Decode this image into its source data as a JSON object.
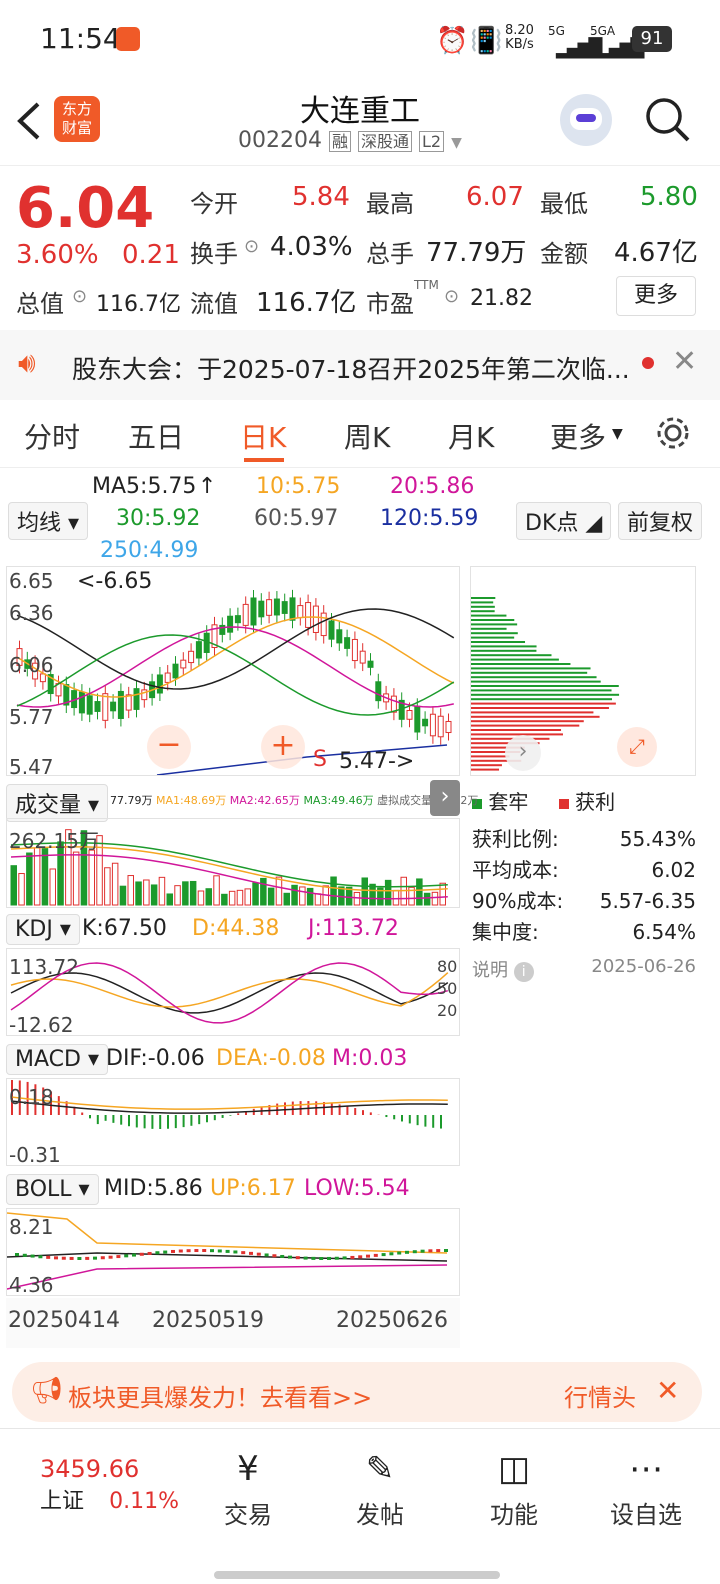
{
  "status_bar": {
    "time": "11:54",
    "net_speed": "8.20",
    "net_unit": "KB/s",
    "sig1": "5G",
    "sig2": "5GA",
    "battery": "91"
  },
  "header": {
    "logo_line1": "东方",
    "logo_line2": "财富",
    "title": "大连重工",
    "code": "002204",
    "tag1": "融",
    "tag2": "深股通",
    "tag3": "L2"
  },
  "quote": {
    "price": "6.04",
    "change_pct": "3.60%",
    "change_amt": "0.21",
    "open_label": "今开",
    "open": "5.84",
    "high_label": "最高",
    "high": "6.07",
    "low_label": "最低",
    "low": "5.80",
    "turnover_label": "换手",
    "turnover": "4.03%",
    "volume_label": "总手",
    "volume": "77.79万",
    "amount_label": "金额",
    "amount": "4.67亿",
    "mktcap_label": "总值",
    "mktcap": "116.7亿",
    "float_label": "流值",
    "float": "116.7亿",
    "pe_label": "市盈",
    "pe_sup": "TTM",
    "pe": "21.82",
    "more": "更多"
  },
  "notice": {
    "text": "股东大会：于2025-07-18召开2025年第二次临..."
  },
  "tabs": [
    "分时",
    "五日",
    "日K",
    "周K",
    "月K",
    "更多"
  ],
  "active_tab": "日K",
  "ma": {
    "label": "均线",
    "ma5": "MA5:5.75",
    "ma10": "10:5.75",
    "ma20": "20:5.86",
    "ma30": "30:5.92",
    "ma60": "60:5.97",
    "ma120": "120:5.59",
    "ma250": "250:4.99",
    "dk": "DK点",
    "fq": "前复权"
  },
  "kline": {
    "y_top": "6.65",
    "y_mid1": "6.36",
    "y_mid2": "6.06",
    "y_mid3": "5.77",
    "y_bot": "5.47",
    "hi_marker": "<-6.65",
    "lo_marker": "5.47->",
    "marker_s": "S"
  },
  "volume_bar": {
    "label": "成交量",
    "values": "77.79万",
    "ma1": "MA1:48.69万",
    "ma2": "MA2:42.65万",
    "ma3": "MA3:49.46万",
    "virtual": "虚拟成交量:97.92万",
    "y_top": "262.15万"
  },
  "kdj": {
    "label": "KDJ",
    "k": "K:67.50",
    "d": "D:44.38",
    "j": "J:113.72",
    "y_top": "113.72",
    "y_bot": "-12.62",
    "r80": "80",
    "r50": "50",
    "r20": "20"
  },
  "macd": {
    "label": "MACD",
    "dif": "DIF:-0.06",
    "dea": "DEA:-0.08",
    "m": "M:0.03",
    "y_top": "0.18",
    "y_bot": "-0.31"
  },
  "boll": {
    "label": "BOLL",
    "mid": "MID:5.86",
    "up": "UP:6.17",
    "low": "LOW:5.54",
    "y_top": "8.21",
    "y_bot": "4.36"
  },
  "dates": [
    "20250414",
    "20250519",
    "20250626"
  ],
  "chips": {
    "legend_trap": "套牢",
    "legend_profit": "获利",
    "rows": [
      {
        "label": "获利比例:",
        "value": "55.43%"
      },
      {
        "label": "平均成本:",
        "value": "6.02"
      },
      {
        "label": "90%成本:",
        "value": "5.57-6.35"
      },
      {
        "label": "集中度:",
        "value": "6.54%"
      }
    ],
    "note_label": "说明",
    "date": "2025-06-26"
  },
  "promo": {
    "text": "板块更具爆发力！去看看>>",
    "right": "行情头"
  },
  "bottom_nav": {
    "index_value": "3459.66",
    "index_name": "上证",
    "index_pct": "0.11%",
    "items": [
      "交易",
      "发帖",
      "功能",
      "设自选"
    ]
  },
  "colors": {
    "red": "#e0312f",
    "green": "#1c9a2c",
    "orange": "#f5a623",
    "magenta": "#d0169a",
    "blue": "#1a2fa0",
    "lightblue": "#3ea6e8"
  }
}
